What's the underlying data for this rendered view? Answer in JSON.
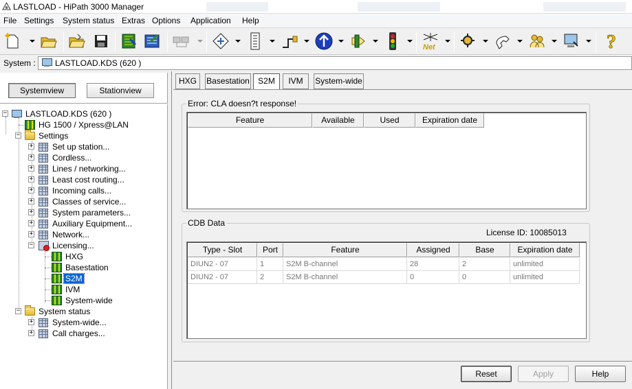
{
  "window": {
    "title": "LASTLOAD - HiPath 3000 Manager"
  },
  "menu": [
    "File",
    "Settings",
    "System status",
    "Extras",
    "Options",
    "Application",
    "Help"
  ],
  "toolbar_icons": [
    "new-file-icon",
    "open-folder-icon",
    "open-folder-alt-icon",
    "save-icon",
    "transfer-icon",
    "transfer-all-icon",
    "network-disabled-icon",
    "diagram-icon",
    "modem-icon",
    "route-icon",
    "globe-arrows-icon",
    "tag-icon",
    "traffic-light-icon",
    "net-icon",
    "gear-tools-icon",
    "handset-icon",
    "people-icon",
    "computer-config-icon",
    "help-icon"
  ],
  "system": {
    "label": "System :",
    "value": "LASTLOAD.KDS (620 )"
  },
  "view_buttons": {
    "system_view": "Systemview",
    "station_view": "Stationview"
  },
  "tree": {
    "root": "LASTLOAD.KDS (620 )",
    "node_hg": "HG 1500 / Xpress@LAN",
    "settings": "Settings",
    "settings_items": [
      "Set up station...",
      "Cordless...",
      "Lines / networking...",
      "Least cost routing...",
      "Incoming calls...",
      "Classes of service...",
      "System parameters...",
      "Auxiliary Equipment...",
      "Network...",
      "Licensing..."
    ],
    "licensing_items": [
      "HXG",
      "Basestation",
      "S2M",
      "IVM",
      "System-wide"
    ],
    "system_status": "System status",
    "system_status_items": [
      "System-wide...",
      "Call charges..."
    ]
  },
  "tabs": [
    "HXG",
    "Basestation",
    "S2M",
    "IVM",
    "System-wide"
  ],
  "active_tab": "S2M",
  "error_group": {
    "title": "Error: CLA doesn?t response!",
    "columns": [
      "Feature",
      "Available",
      "Used",
      "Expiration date"
    ]
  },
  "cdb_group": {
    "title": "CDB Data",
    "license_label": "License ID: 10085013",
    "columns": [
      "Type - Slot",
      "Port",
      "Feature",
      "Assigned",
      "Base",
      "Expiration date"
    ],
    "rows": [
      [
        "DIUN2 - 07",
        "1",
        "S2M B-channel",
        "28",
        "2",
        "unlimited"
      ],
      [
        "DIUN2 - 07",
        "2",
        "S2M B-channel",
        "0",
        "0",
        "unlimited"
      ]
    ]
  },
  "buttons": {
    "reset": "Reset",
    "apply": "Apply",
    "help": "Help"
  }
}
